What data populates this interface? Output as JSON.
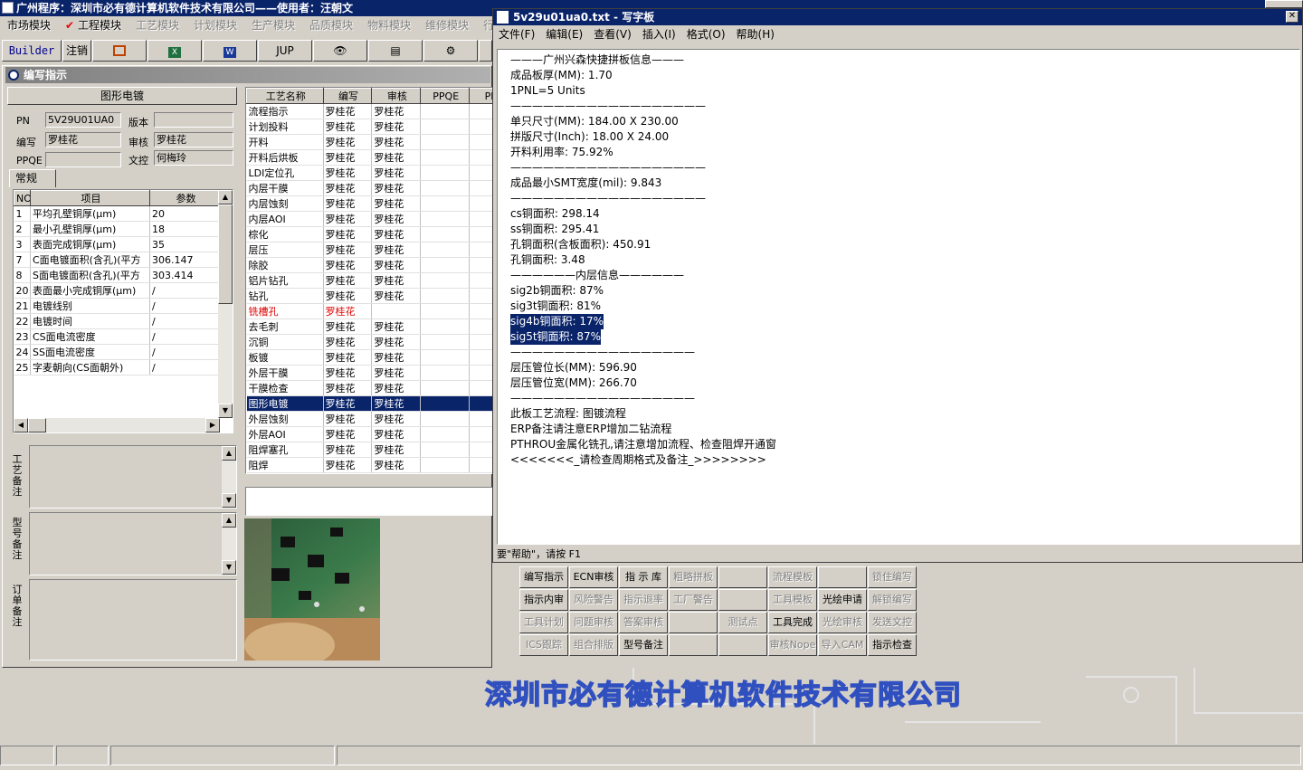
{
  "app": {
    "title": "广州程序：深圳市必有德计算机软件技术有限公司——使用者：汪朝文"
  },
  "menu": [
    "市场模块",
    "工程模块",
    "工艺模块",
    "计划模块",
    "生产模块",
    "品质模块",
    "物料模块",
    "维修模块",
    "行政模"
  ],
  "toolbar": {
    "builder": "Builder",
    "logout": "注销",
    "jup": "JUP"
  },
  "child": {
    "title": "编写指示",
    "section": "图形电镀",
    "pn_label": "PN",
    "pn": "5V29U01UA0",
    "ver_label": "版本",
    "ver": "",
    "writer_label": "编写",
    "writer": "罗桂花",
    "review_label": "审核",
    "review": "罗桂花",
    "ppqe_label": "PPQE",
    "ppqe": "",
    "doc_label": "文控",
    "doc": "何梅玲",
    "tab": "常规"
  },
  "params": {
    "headers": [
      "NO",
      "项目",
      "参数"
    ],
    "rows": [
      [
        "1",
        "平均孔壁铜厚(μm)",
        "20"
      ],
      [
        "2",
        "最小孔壁铜厚(μm)",
        "18"
      ],
      [
        "3",
        "表面完成铜厚(μm)",
        "35"
      ],
      [
        "7",
        "C面电镀面积(含孔)(平方",
        "306.147"
      ],
      [
        "8",
        "S面电镀面积(含孔)(平方",
        "303.414"
      ],
      [
        "20",
        "表面最小完成铜厚(μm)",
        "/"
      ],
      [
        "21",
        "电镀线别",
        "/"
      ],
      [
        "22",
        "电镀时间",
        "/"
      ],
      [
        "23",
        "CS面电流密度",
        "/"
      ],
      [
        "24",
        "SS面电流密度",
        "/"
      ],
      [
        "25",
        "字麦朝向(CS面朝外)",
        "/"
      ]
    ]
  },
  "remarks": [
    "工艺备注",
    "型号备注",
    "订单备注"
  ],
  "process": {
    "headers": [
      "工艺名称",
      "编写",
      "审核",
      "PPQE",
      "PPC"
    ],
    "rows": [
      [
        "流程指示",
        "罗桂花",
        "罗桂花"
      ],
      [
        "计划投料",
        "罗桂花",
        "罗桂花"
      ],
      [
        "开料",
        "罗桂花",
        "罗桂花"
      ],
      [
        "开料后烘板",
        "罗桂花",
        "罗桂花"
      ],
      [
        "LDI定位孔",
        "罗桂花",
        "罗桂花"
      ],
      [
        "内层干膜",
        "罗桂花",
        "罗桂花"
      ],
      [
        "内层蚀刻",
        "罗桂花",
        "罗桂花"
      ],
      [
        "内层AOI",
        "罗桂花",
        "罗桂花"
      ],
      [
        "棕化",
        "罗桂花",
        "罗桂花"
      ],
      [
        "层压",
        "罗桂花",
        "罗桂花"
      ],
      [
        "除胶",
        "罗桂花",
        "罗桂花"
      ],
      [
        "铝片钻孔",
        "罗桂花",
        "罗桂花"
      ],
      [
        "钻孔",
        "罗桂花",
        "罗桂花"
      ],
      [
        "铣槽孔",
        "罗桂花",
        ""
      ],
      [
        "去毛刺",
        "罗桂花",
        "罗桂花"
      ],
      [
        "沉铜",
        "罗桂花",
        "罗桂花"
      ],
      [
        "板镀",
        "罗桂花",
        "罗桂花"
      ],
      [
        "外层干膜",
        "罗桂花",
        "罗桂花"
      ],
      [
        "干膜检查",
        "罗桂花",
        "罗桂花"
      ],
      [
        "图形电镀",
        "罗桂花",
        "罗桂花"
      ],
      [
        "外层蚀刻",
        "罗桂花",
        "罗桂花"
      ],
      [
        "外层AOI",
        "罗桂花",
        "罗桂花"
      ],
      [
        "阻焊塞孔",
        "罗桂花",
        "罗桂花"
      ],
      [
        "阻焊",
        "罗桂花",
        "罗桂花"
      ]
    ]
  },
  "wordpad": {
    "title": "5v29u01ua0.txt - 写字板",
    "menu": [
      "文件(F)",
      "编辑(E)",
      "查看(V)",
      "插入(I)",
      "格式(O)",
      "帮助(H)"
    ],
    "lines": [
      "———广州兴森快捷拼板信息———",
      "成品板厚(MM): 1.70",
      "1PNL=5 Units",
      "——————————————————",
      "单只尺寸(MM): 184.00 X 230.00",
      "拼版尺寸(Inch): 18.00 X 24.00",
      "开料利用率: 75.92%",
      "——————————————————",
      "成品最小SMT宽度(mil): 9.843",
      "——————————————————",
      "cs铜面积: 298.14",
      "ss铜面积: 295.41",
      "孔铜面积(含板面积): 450.91",
      "孔铜面积: 3.48",
      "——————内层信息——————",
      "sig2b铜面积: 87%",
      "sig3t铜面积: 81%",
      "sig4b铜面积: 17%",
      "sig5t铜面积: 87%",
      "—————————————————",
      "层压管位长(MM): 596.90",
      "层压管位宽(MM): 266.70",
      "—————————————————",
      "此板工艺流程: 图镀流程",
      "ERP备注请注意ERP增加二钻流程",
      "PTHROU金属化铣孔,请注意增加流程、检查阻焊开通窗",
      "<<<<<<<_请检查周期格式及备注_>>>>>>>>"
    ],
    "status": "要\"帮助\"，请按 F1"
  },
  "buttons": [
    [
      "编写指示",
      "ECN审核",
      "指 示 库",
      "粗略拼板",
      "",
      "流程模板",
      "",
      "锁住编写"
    ],
    [
      "指示内审",
      "风险警告",
      "指示退率",
      "工厂警告",
      "",
      "工具模板",
      "光绘申请",
      "解锁编写"
    ],
    [
      "工具计划",
      "问题审核",
      "答案审核",
      "",
      "测试点",
      "工具完成",
      "光绘审核",
      "发送文控"
    ],
    [
      "ICS跟踪",
      "组合排版",
      "型号备注",
      "",
      "",
      "审核Nope",
      "导入CAM",
      "指示检查"
    ]
  ],
  "buttons_enabled": [
    [
      1,
      1,
      1,
      0,
      0,
      0,
      0,
      0
    ],
    [
      1,
      0,
      0,
      0,
      0,
      0,
      1,
      0
    ],
    [
      0,
      0,
      0,
      0,
      0,
      1,
      0,
      0
    ],
    [
      0,
      0,
      1,
      0,
      0,
      0,
      0,
      1
    ]
  ],
  "banner": "深圳市必有德计算机软件技术有限公司"
}
